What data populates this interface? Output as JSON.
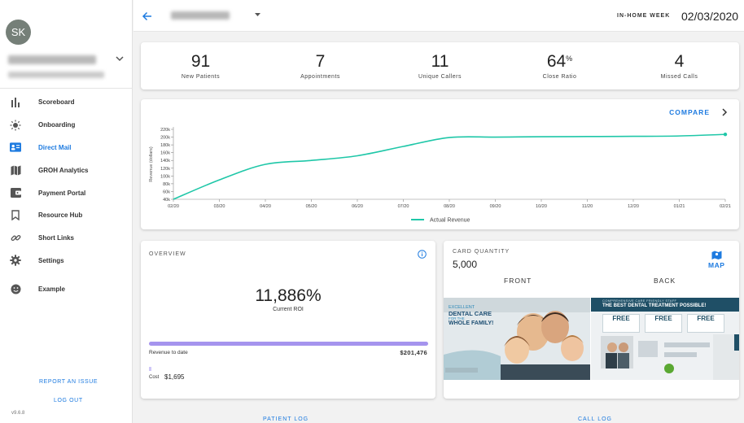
{
  "user": {
    "initials": "SK"
  },
  "nav": [
    {
      "label": "Scoreboard",
      "icon": "bar-chart-icon"
    },
    {
      "label": "Onboarding",
      "icon": "sun-icon"
    },
    {
      "label": "Direct Mail",
      "icon": "contact-card-icon",
      "active": true
    },
    {
      "label": "GROH Analytics",
      "icon": "map-icon"
    },
    {
      "label": "Payment Portal",
      "icon": "wallet-icon"
    },
    {
      "label": "Resource Hub",
      "icon": "bookmark-icon"
    },
    {
      "label": "Short Links",
      "icon": "link-icon"
    },
    {
      "label": "Settings",
      "icon": "gear-icon"
    },
    {
      "label": "Example",
      "icon": "smiley-icon"
    }
  ],
  "sidebar_links": {
    "report": "REPORT AN ISSUE",
    "logout": "LOG OUT",
    "version": "v9.6.8"
  },
  "header": {
    "week_label": "IN-HOME WEEK",
    "week_date": "02/03/2020"
  },
  "stats": [
    {
      "value": "91",
      "label": "New Patients"
    },
    {
      "value": "7",
      "label": "Appointments"
    },
    {
      "value": "11",
      "label": "Unique Callers"
    },
    {
      "value": "64",
      "suffix": "%",
      "label": "Close Ratio"
    },
    {
      "value": "4",
      "label": "Missed Calls"
    }
  ],
  "compare_label": "COMPARE",
  "chart_data": {
    "type": "line",
    "ylabel": "Revenue (dollars)",
    "yticks": [
      "40k",
      "60k",
      "80k",
      "100k",
      "120k",
      "140k",
      "160k",
      "180k",
      "200k",
      "220k"
    ],
    "ylim": [
      40000,
      220000
    ],
    "xticks": [
      "02/20",
      "03/20",
      "04/20",
      "05/20",
      "06/20",
      "07/20",
      "08/20",
      "09/20",
      "10/20",
      "11/20",
      "12/20",
      "01/21",
      "02/21"
    ],
    "series": [
      {
        "name": "Actual Revenue",
        "color": "#1fc7a8",
        "values": [
          40000,
          90000,
          130000,
          140000,
          152000,
          176000,
          199000,
          200000,
          201000,
          201500,
          202000,
          203000,
          207000
        ]
      }
    ],
    "legend": "bottom"
  },
  "overview": {
    "title": "OVERVIEW",
    "roi": "11,886%",
    "roi_label": "Current ROI",
    "revenue_label": "Revenue to date",
    "revenue_value": "$201,476",
    "cost_label": "Cost",
    "cost_value": "$1,695",
    "revenue_fraction": 1.0
  },
  "card_quantity": {
    "title": "CARD QUANTITY",
    "value": "5,000",
    "map_label": "MAP",
    "front_label": "FRONT",
    "back_label": "BACK",
    "front_text": [
      "EXCELLENT",
      "DENTAL CARE",
      "FOR THE",
      "WHOLE FAMILY!"
    ],
    "back_text": [
      "COMPREHENSIVE CARE FRIENDLY STAFF",
      "THE BEST DENTAL TREATMENT POSSIBLE!",
      "FREE",
      "FREE",
      "FREE"
    ]
  },
  "colors": {
    "accent": "#1e7be0",
    "line": "#1fc7a8",
    "revenue_bar": "#a594ee"
  }
}
